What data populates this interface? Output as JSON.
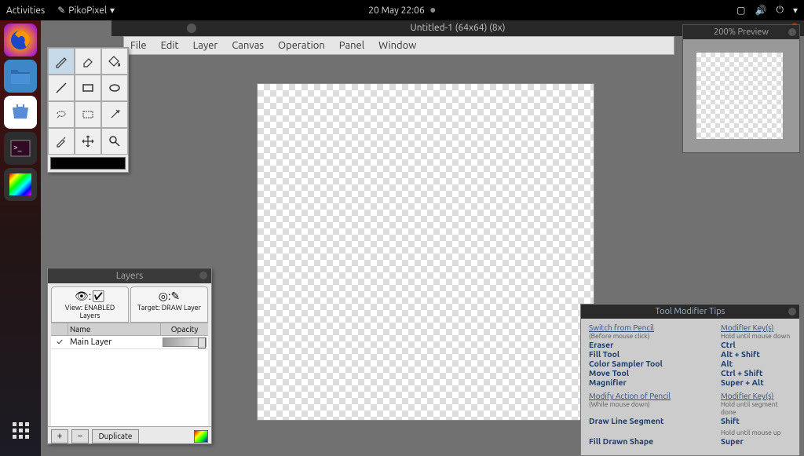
{
  "topbar": {
    "activities": "Activities",
    "app_name": "PikoPixel",
    "clock": "20 May  22:06"
  },
  "window": {
    "title": "Untitled-1 (64x64) (8x)"
  },
  "menubar": [
    "File",
    "Edit",
    "Layer",
    "Canvas",
    "Operation",
    "Panel",
    "Window"
  ],
  "preview": {
    "title": "200% Preview"
  },
  "layers": {
    "title": "Layers",
    "tab_view": "View: ENABLED Layers",
    "tab_target": "Target: DRAW Layer",
    "col_name": "Name",
    "col_opacity": "Opacity",
    "rows": [
      {
        "name": "Main Layer"
      }
    ],
    "add": "+",
    "remove": "−",
    "duplicate": "Duplicate"
  },
  "tips": {
    "title": "Tool Modifier Tips",
    "section1_left_header": "Switch from Pencil",
    "section1_right_header": "Modifier Key(s)",
    "section1_left_note": "(Before mouse click)",
    "section1_right_note": "Hold until mouse down",
    "rows1": [
      {
        "l": "Eraser",
        "r": "Ctrl"
      },
      {
        "l": "Fill Tool",
        "r": "Alt + Shift"
      },
      {
        "l": "Color Sampler Tool",
        "r": "Alt"
      },
      {
        "l": "Move Tool",
        "r": "Ctrl + Shift"
      },
      {
        "l": "Magnifier",
        "r": "Super + Alt"
      }
    ],
    "section2_left_header": "Modify Action of Pencil",
    "section2_right_header": "Modifier Key(s)",
    "section2_left_note": "(While mouse down)",
    "section2_right_note": "Hold until segment done",
    "row2": {
      "l": "Draw Line Segment",
      "r": "Shift"
    },
    "section3_right_note": "Hold until mouse up",
    "row3": {
      "l": "Fill Drawn Shape",
      "r": "Super"
    }
  }
}
